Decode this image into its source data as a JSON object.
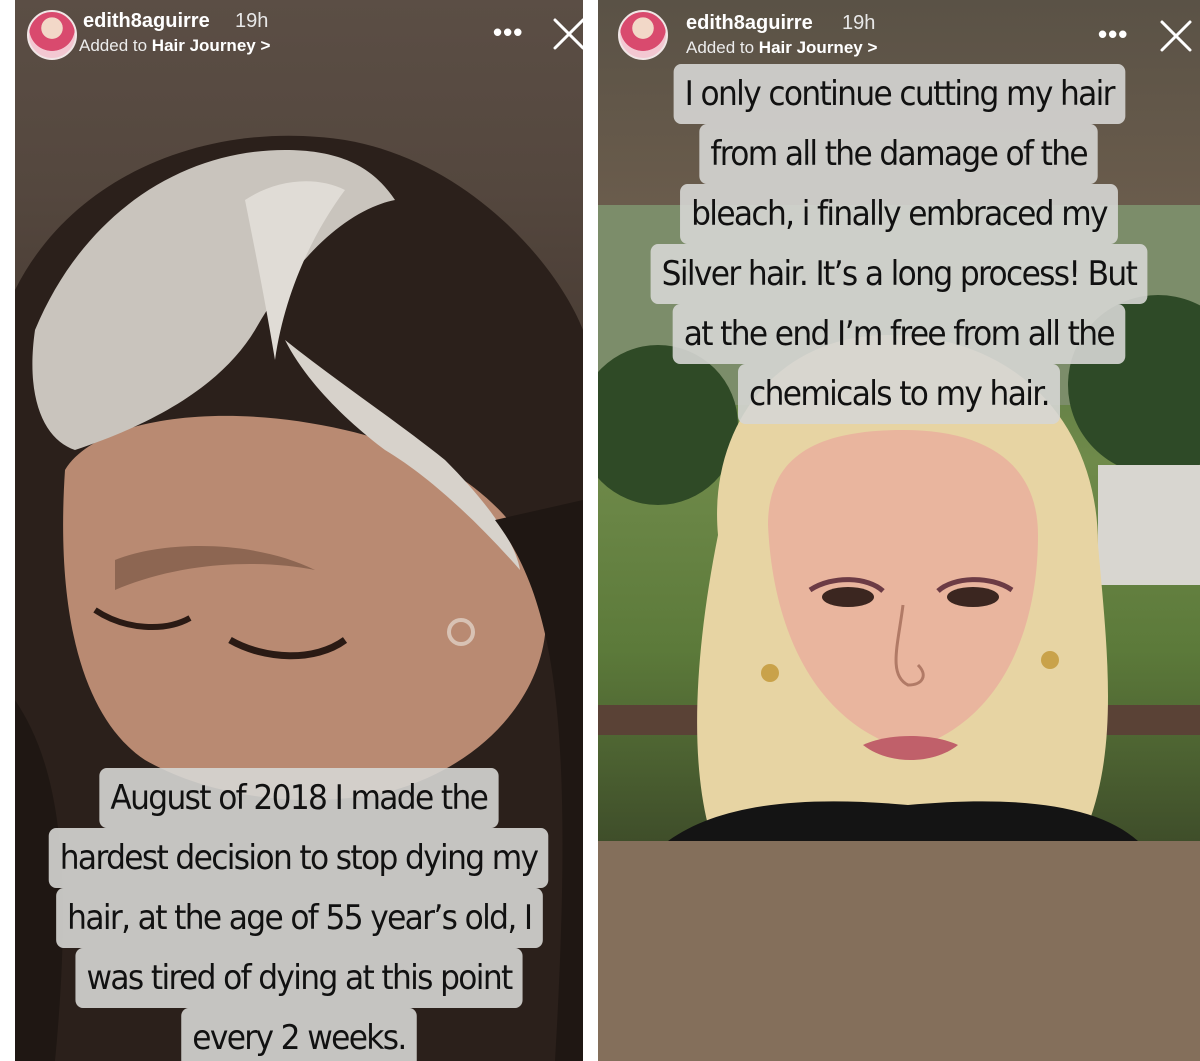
{
  "stories": [
    {
      "username": "edith8aguirre",
      "time": "19h",
      "added_to_prefix": "Added to",
      "album": "Hair Journey",
      "album_chevron": ">",
      "more_icon": "more-horizontal-icon",
      "close_icon": "close-icon",
      "caption_lines": [
        "August of 2018 I made the",
        "hardest decision to stop dying my",
        "hair, at the age of 55 year’s old, I",
        "was tired of dying at this point",
        "every 2 weeks."
      ]
    },
    {
      "username": "edith8aguirre",
      "time": "19h",
      "added_to_prefix": "Added to",
      "album": "Hair Journey",
      "album_chevron": ">",
      "more_icon": "more-horizontal-icon",
      "close_icon": "close-icon",
      "caption_lines": [
        "I only continue cutting my hair",
        "from all the damage of the",
        "bleach, i finally embraced my",
        "Silver hair. It’s a long process! But",
        "at the end I’m free from all the",
        "chemicals to my hair."
      ]
    }
  ]
}
